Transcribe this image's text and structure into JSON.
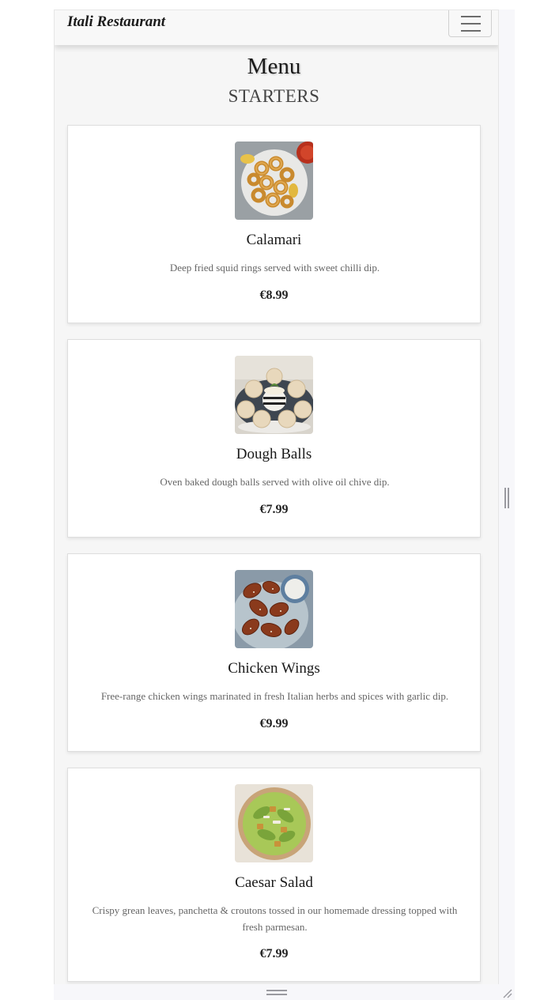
{
  "navbar": {
    "brand": "Itali Restaurant",
    "toggle_icon": "hamburger-menu-icon"
  },
  "page": {
    "title": "Menu",
    "section": "STARTERS"
  },
  "items": [
    {
      "name": "Calamari",
      "description": "Deep fried squid rings served with sweet chilli dip.",
      "price": "€8.99",
      "image": "calamari-photo"
    },
    {
      "name": "Dough Balls",
      "description": "Oven baked dough balls served with olive oil chive dip.",
      "price": "€7.99",
      "image": "dough-balls-photo"
    },
    {
      "name": "Chicken Wings",
      "description": "Free-range chicken wings marinated in fresh Italian herbs and spices with garlic dip.",
      "price": "€9.99",
      "image": "chicken-wings-photo"
    },
    {
      "name": "Caesar Salad",
      "description": "Crispy grean leaves, panchetta & croutons tossed in our homemade dressing topped with fresh parmesan.",
      "price": "€7.99",
      "image": "caesar-salad-photo"
    }
  ],
  "colors": {
    "page_background": "#f6f6f6",
    "card_background": "#ffffff",
    "navbar_background": "#f8f8f8",
    "text_dark": "#1a1a1a",
    "text_muted": "#666666"
  }
}
